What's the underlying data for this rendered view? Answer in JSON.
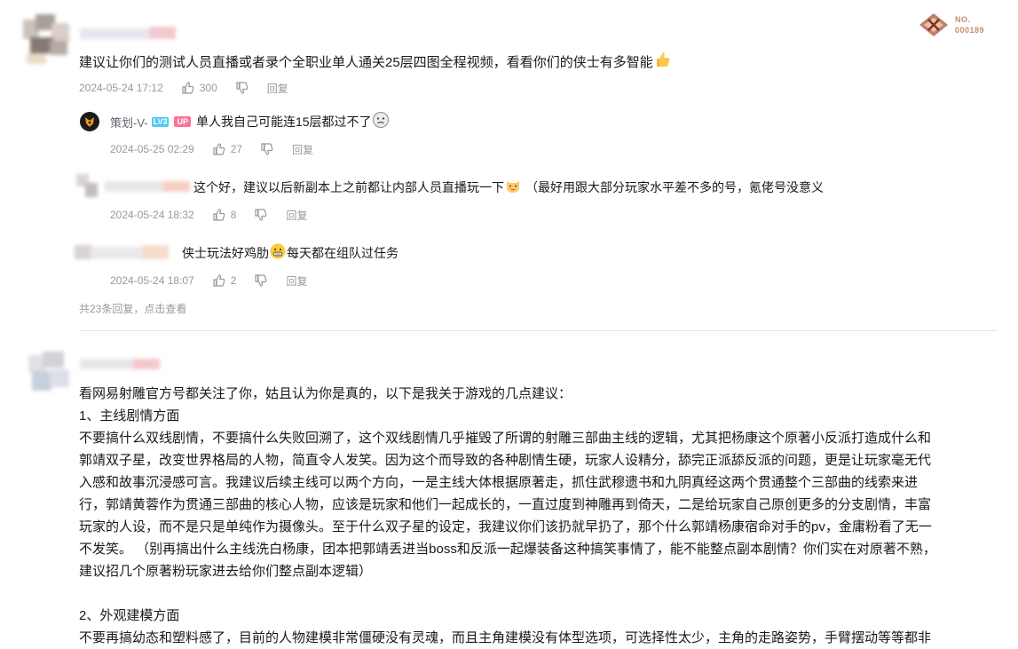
{
  "badge": {
    "line1": "NO.",
    "line2": "000189"
  },
  "comment1": {
    "text": "建议让你们的测试人员直播或者录个全职业单人通关25层四图全程视频，看看你们的侠士有多智能",
    "emoji": "thumbs-up",
    "date": "2024-05-24 17:12",
    "likes": "300",
    "reply_label": "回复"
  },
  "replies": [
    {
      "username": "策划-V-",
      "level": "LV3",
      "up_tag": "UP",
      "text": "单人我自己可能连15层都过不了",
      "emoji": "sad-face",
      "date": "2024-05-25 02:29",
      "likes": "27",
      "reply_label": "回复"
    },
    {
      "text": "这个好，建议以后新副本上之前都让内部人员直播玩一下",
      "emoji": "cat-face",
      "text2": "（最好用跟大部分玩家水平差不多的号，氪佬号没意义",
      "date": "2024-05-24 18:32",
      "likes": "8",
      "reply_label": "回复"
    },
    {
      "text": "侠士玩法好鸡肋",
      "emoji": "grimace-face",
      "text2": "每天都在组队过任务",
      "date": "2024-05-24 18:07",
      "likes": "2",
      "reply_label": "回复"
    }
  ],
  "more_replies": "共23条回复，点击查看",
  "comment2": {
    "lines": [
      "看网易射雕官方号都关注了你，姑且认为你是真的，以下是我关于游戏的几点建议：",
      "1、主线剧情方面",
      "不要搞什么双线剧情，不要搞什么失败回溯了，这个双线剧情几乎摧毁了所谓的射雕三部曲主线的逻辑，尤其把杨康这个原著小反派打造成什么和",
      "郭靖双子星，改变世界格局的人物，简直令人发笑。因为这个而导致的各种剧情生硬，玩家人设精分，舔完正派舔反派的问题，更是让玩家毫无代",
      "入感和故事沉浸感可言。我建议后续主线可以两个方向，一是主线大体根据原著走，抓住武穆遗书和九阴真经这两个贯通整个三部曲的线索来进",
      "行，郭靖黄蓉作为贯通三部曲的核心人物，应该是玩家和他们一起成长的，一直过度到神雕再到倚天，二是给玩家自己原创更多的分支剧情，丰富",
      "玩家的人设，而不是只是单纯作为摄像头。至于什么双子星的设定，我建议你们该扔就早扔了，那个什么郭靖杨康宿命对手的pv，金庸粉看了无一",
      "不发笑。 （别再搞出什么主线洗白杨康，团本把郭靖丢进当boss和反派一起爆装备这种搞笑事情了，能不能整点副本剧情？你们实在对原著不熟，",
      "建议招几个原著粉玩家进去给你们整点副本逻辑）",
      "",
      "2、外观建模方面",
      "不要再搞幼态和塑料感了，目前的人物建模非常僵硬没有灵魂，而且主角建模没有体型选项，可选择性太少，主角的走路姿势，手臂摆动等等都非"
    ]
  }
}
